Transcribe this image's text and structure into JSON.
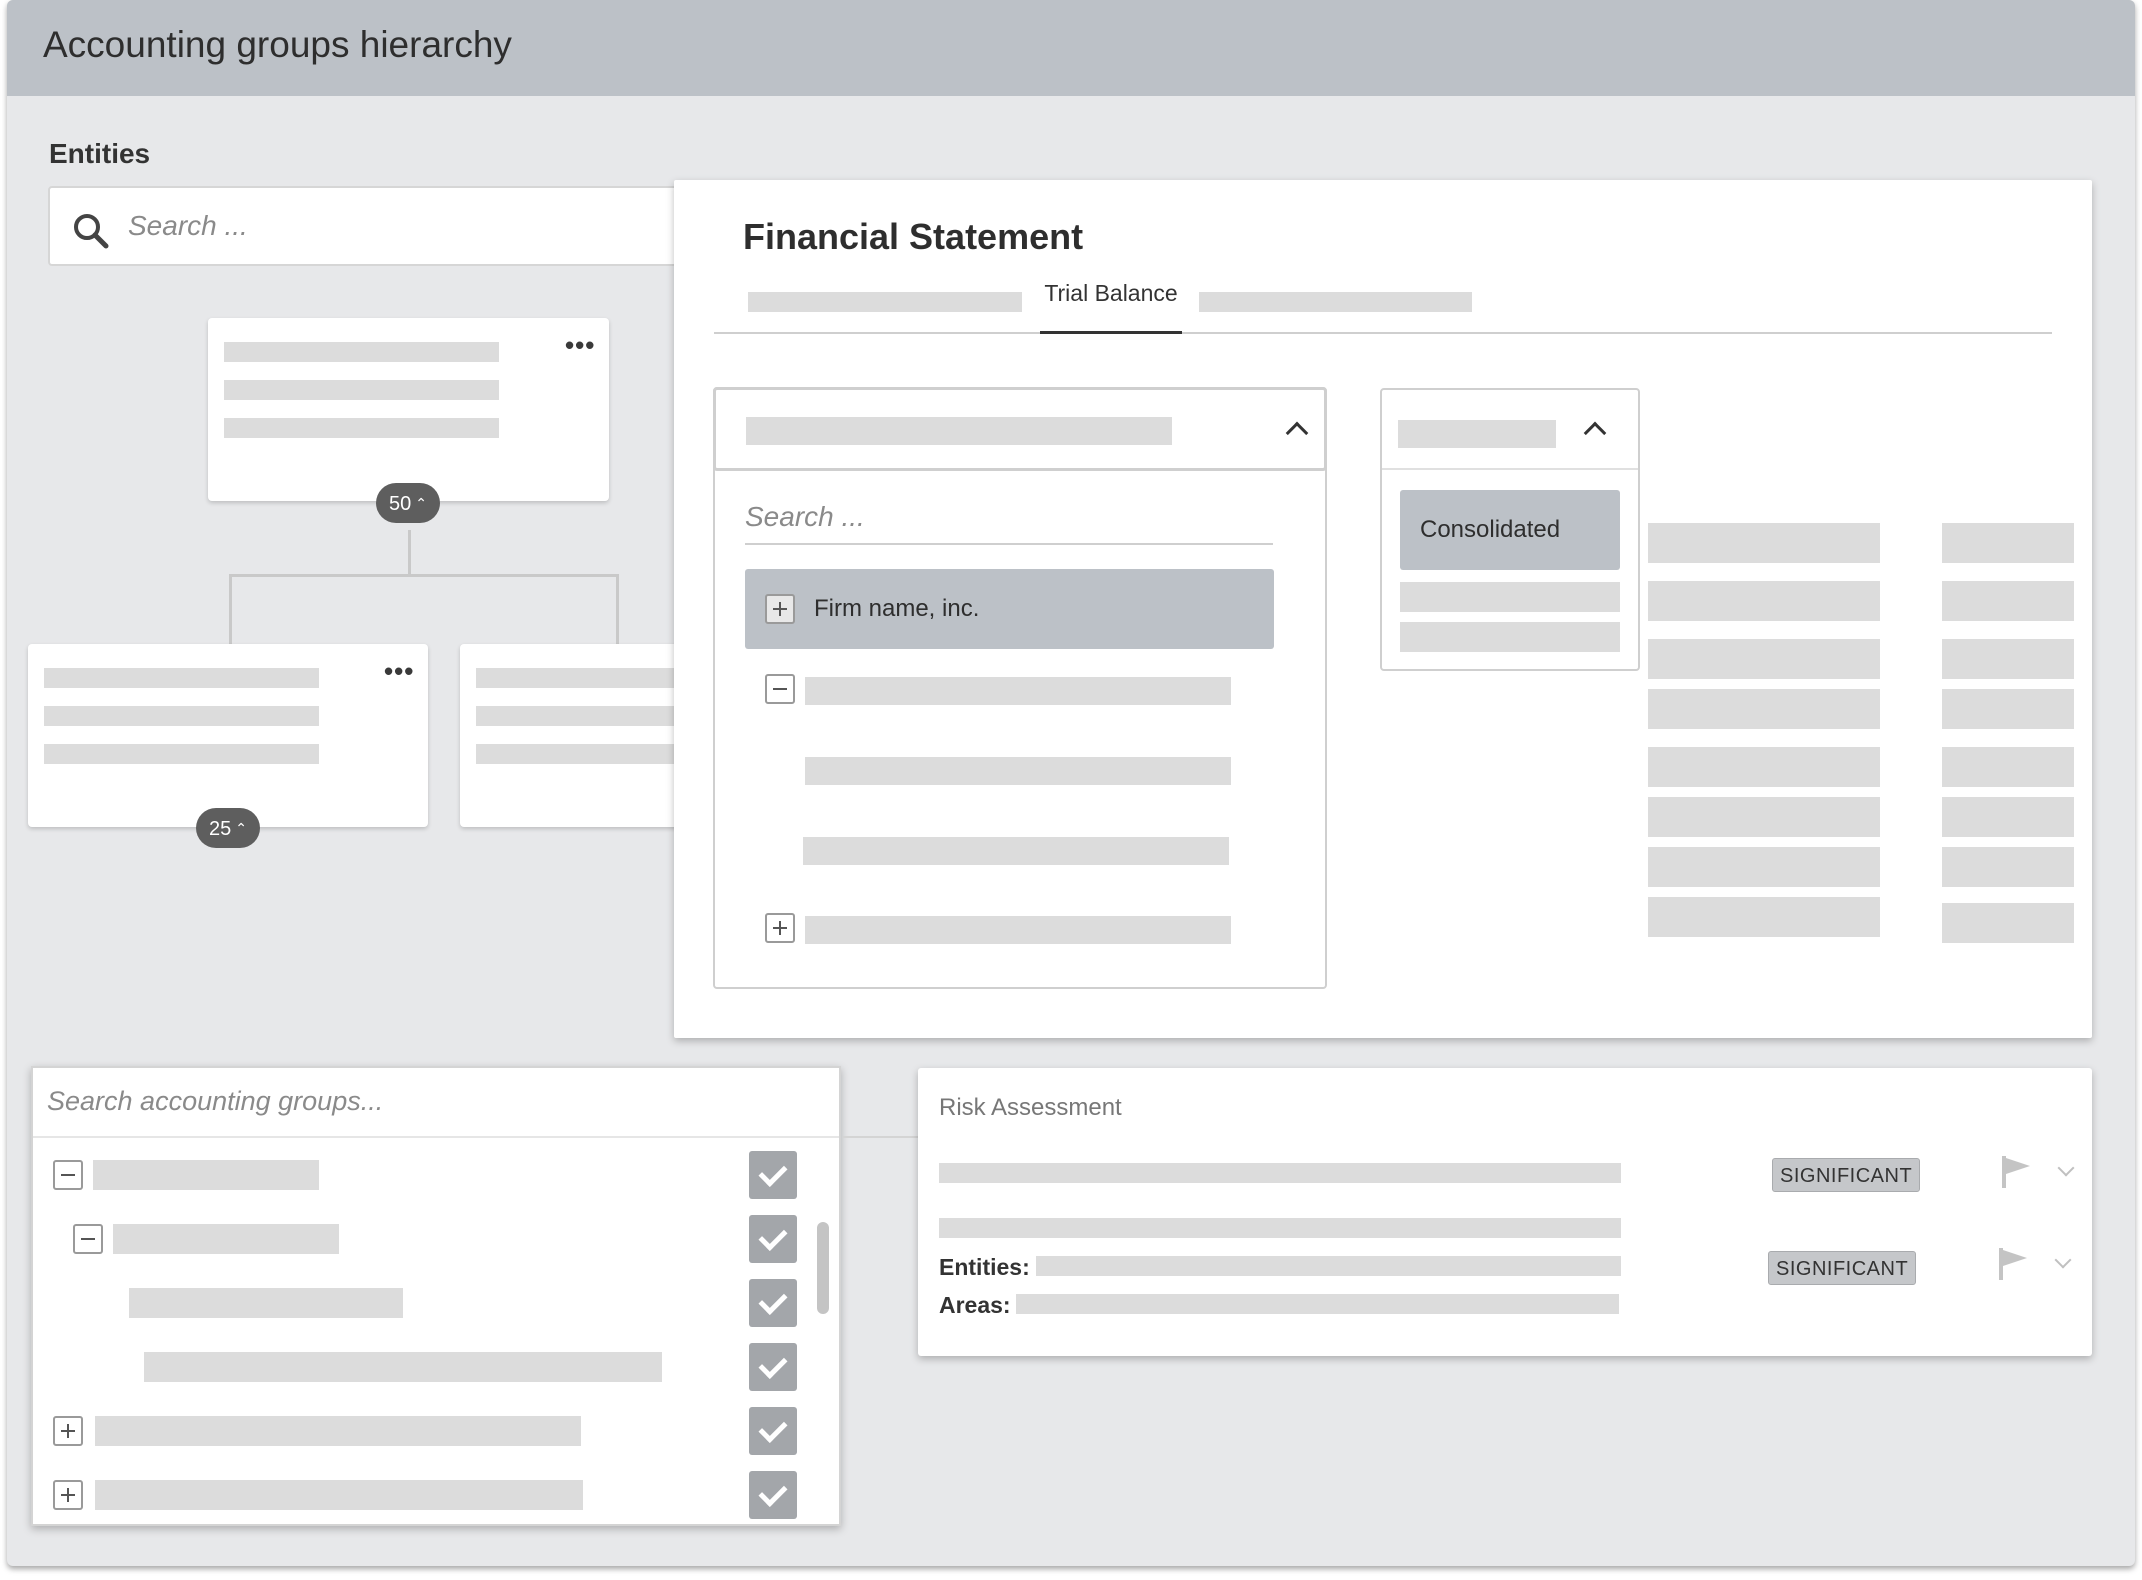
{
  "window": {
    "title": "Accounting groups hierarchy"
  },
  "entities": {
    "label": "Entities",
    "search_placeholder": "Search ...",
    "root_card": {
      "count": "50"
    },
    "child_cards": [
      {
        "count": "25"
      },
      {}
    ]
  },
  "financial_statement": {
    "title": "Financial Statement",
    "tabs": [
      {
        "label": ""
      },
      {
        "label": "Trial Balance",
        "active": true
      },
      {
        "label": ""
      }
    ],
    "entity_dropdown": {
      "search_placeholder": "Search ...",
      "items": [
        {
          "label": "Firm name, inc.",
          "selected": true,
          "toggle": "plus"
        },
        {
          "label": "",
          "toggle": "minus"
        },
        {
          "label": ""
        },
        {
          "label": ""
        },
        {
          "label": "",
          "toggle": "plus"
        }
      ]
    },
    "view_dropdown": {
      "options": [
        {
          "label": "Consolidated",
          "selected": true
        },
        {
          "label": ""
        },
        {
          "label": ""
        }
      ]
    }
  },
  "accounting_groups": {
    "search_placeholder": "Search accounting groups...",
    "rows": [
      {
        "toggle": "minus",
        "checked": true
      },
      {
        "toggle": "minus",
        "checked": true
      },
      {
        "checked": true
      },
      {
        "checked": true
      },
      {
        "toggle": "plus",
        "checked": true
      },
      {
        "toggle": "plus",
        "checked": true
      }
    ]
  },
  "risk_assessment": {
    "title": "Risk Assessment",
    "rows": [
      {
        "badge": "SIGNIFICANT"
      },
      {
        "entities_label": "Entities:",
        "areas_label": "Areas:",
        "badge": "SIGNIFICANT"
      }
    ]
  },
  "colors": {
    "titlebar": "#bcc1c7",
    "background": "#e7e8ea",
    "selected": "#bcc1c7",
    "placeholder_bar": "#dcdcdc",
    "check": "#a3a6aa"
  },
  "icons": [
    "search-icon",
    "more-icon",
    "chevron-up-icon",
    "plus-icon",
    "minus-icon",
    "check-icon",
    "flag-icon",
    "chevron-down-icon"
  ]
}
